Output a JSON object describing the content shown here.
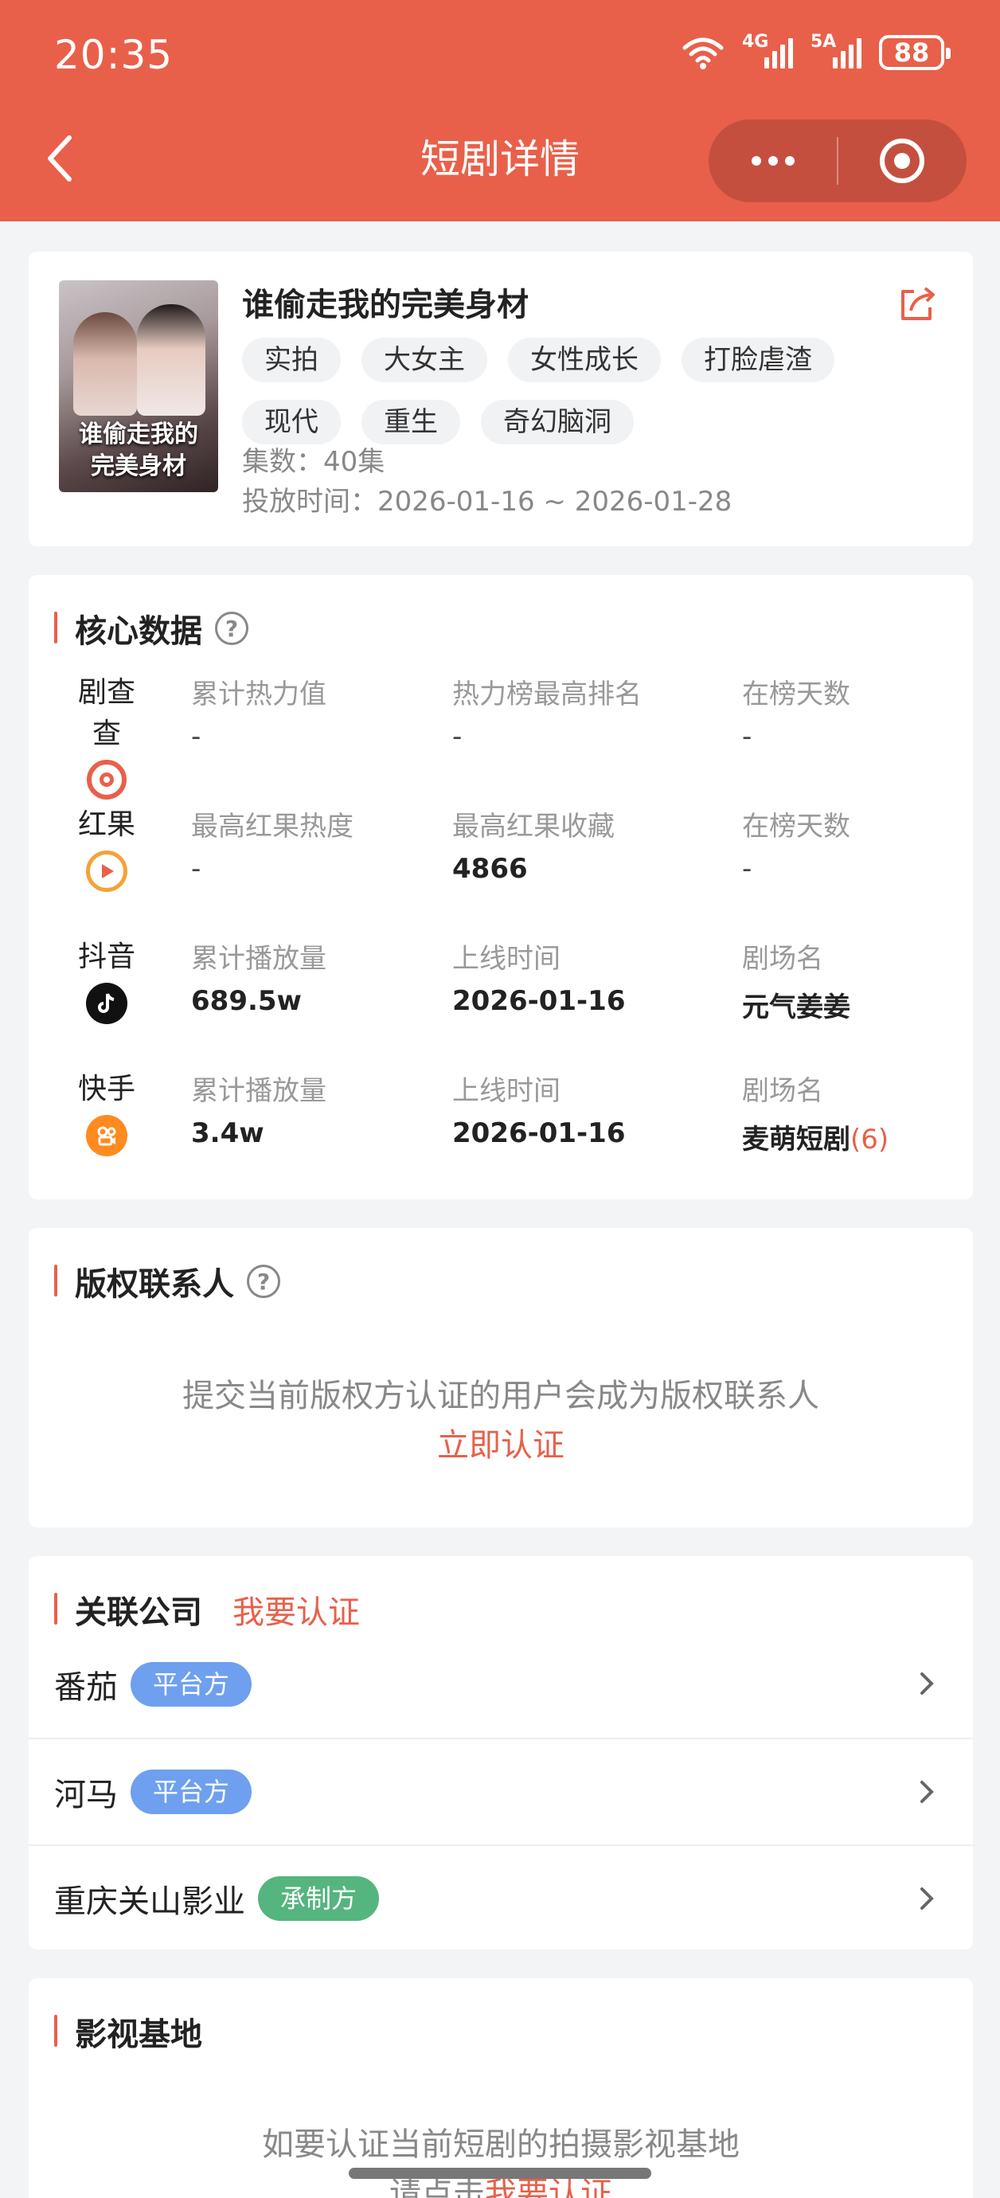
{
  "status_bar": {
    "time": "20:35",
    "signal1": "4G",
    "signal2": "5A",
    "battery": "88"
  },
  "nav": {
    "title": "短剧详情"
  },
  "drama": {
    "title": "谁偷走我的完美身材",
    "poster_text_line1": "谁偷走我的",
    "poster_text_line2": "完美身材",
    "tags": [
      "实拍",
      "大女主",
      "女性成长",
      "打脸虐渣",
      "现代",
      "重生",
      "奇幻脑洞"
    ],
    "episodes": "集数：40集",
    "release_period": "投放时间：2026-01-16 ~ 2026-01-28"
  },
  "core_data": {
    "title": "核心数据",
    "rows": [
      {
        "platform": "剧查查",
        "icon": "juchacha-icon",
        "color": "#e8604a",
        "cols": [
          {
            "k": "累计热力值",
            "v": "-"
          },
          {
            "k": "热力榜最高排名",
            "v": "-"
          },
          {
            "k": "在榜天数",
            "v": "-"
          }
        ]
      },
      {
        "platform": "红果",
        "icon": "hongguo-icon",
        "color": "#f07a3a",
        "cols": [
          {
            "k": "最高红果热度",
            "v": "-"
          },
          {
            "k": "最高红果收藏",
            "v": "4866"
          },
          {
            "k": "在榜天数",
            "v": "-"
          }
        ]
      },
      {
        "platform": "抖音",
        "icon": "douyin-icon",
        "color": "#111111",
        "cols": [
          {
            "k": "累计播放量",
            "v": "689.5w"
          },
          {
            "k": "上线时间",
            "v": "2026-01-16"
          },
          {
            "k": "剧场名",
            "v": "元气姜姜"
          }
        ]
      },
      {
        "platform": "快手",
        "icon": "kuaishou-icon",
        "color": "#ff8a1f",
        "cols": [
          {
            "k": "累计播放量",
            "v": "3.4w"
          },
          {
            "k": "上线时间",
            "v": "2026-01-16"
          },
          {
            "k": "剧场名",
            "v": "麦萌短剧",
            "extra": "(6)"
          }
        ]
      }
    ]
  },
  "copyright": {
    "title": "版权联系人",
    "desc": "提交当前版权方认证的用户会成为版权联系人",
    "action": "立即认证"
  },
  "companies": {
    "title": "关联公司",
    "action": "我要认证",
    "items": [
      {
        "name": "番茄",
        "badge": "平台方",
        "badge_color": "#6ea0ef"
      },
      {
        "name": "河马",
        "badge": "平台方",
        "badge_color": "#6ea0ef"
      },
      {
        "name": "重庆关山影业",
        "badge": "承制方",
        "badge_color": "#55b57e"
      }
    ]
  },
  "studio_base": {
    "title": "影视基地",
    "desc": "如要认证当前短剧的拍摄影视基地",
    "desc2_prefix": "请点击",
    "action": "我要认证"
  },
  "colors": {
    "accent": "#e8604a",
    "background": "#f3f4f6"
  }
}
